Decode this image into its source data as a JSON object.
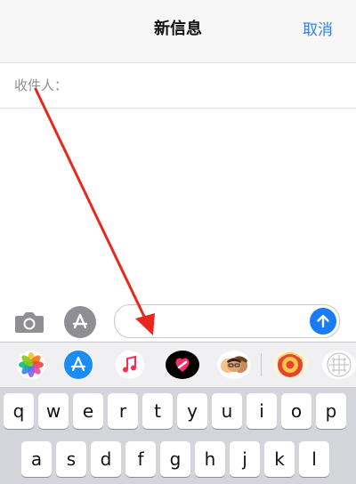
{
  "navbar": {
    "title": "新信息",
    "cancel_label": "取消"
  },
  "recipient": {
    "label": "收件人："
  },
  "compose": {
    "message_placeholder": ""
  },
  "app_drawer": {
    "apps": [
      {
        "name": "photos-icon"
      },
      {
        "name": "appstore-icon"
      },
      {
        "name": "music-icon"
      },
      {
        "name": "digital-touch-icon"
      },
      {
        "name": "memoji-icon"
      },
      {
        "name": "game-app-icon"
      },
      {
        "name": "grid-app-icon"
      }
    ]
  },
  "keyboard": {
    "row1": [
      "q",
      "w",
      "e",
      "r",
      "t",
      "y",
      "u",
      "i",
      "o",
      "p"
    ],
    "row2": [
      "a",
      "s",
      "d",
      "f",
      "g",
      "h",
      "j",
      "k",
      "l"
    ]
  },
  "colors": {
    "accent": "#2f7ff0",
    "send": "#1a7cf5",
    "annotation_arrow": "#e8281d"
  }
}
